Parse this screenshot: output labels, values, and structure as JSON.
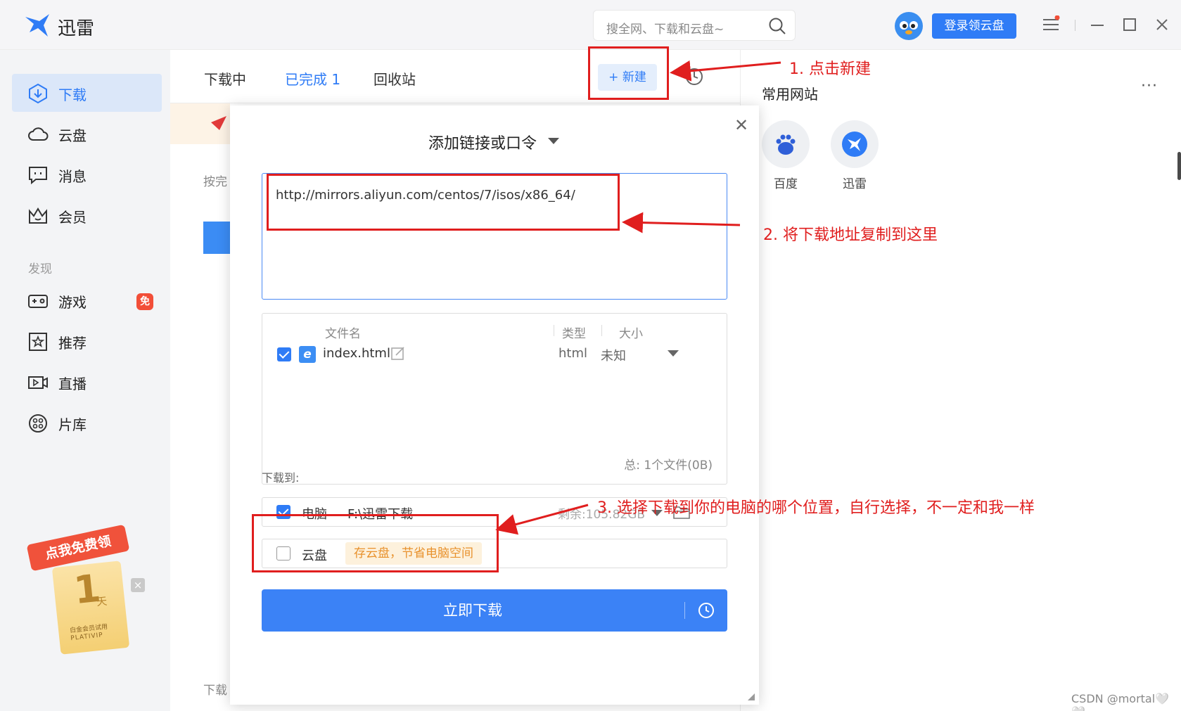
{
  "app": {
    "name": "迅雷"
  },
  "search": {
    "placeholder": "搜全网、下载和云盘~"
  },
  "header": {
    "login_label": "登录领云盘"
  },
  "sidebar": {
    "items": [
      {
        "label": "下载",
        "icon": "download-icon",
        "active": true
      },
      {
        "label": "云盘",
        "icon": "cloud-icon"
      },
      {
        "label": "消息",
        "icon": "message-icon"
      },
      {
        "label": "会员",
        "icon": "crown-icon"
      }
    ],
    "section_label": "发现",
    "discover_items": [
      {
        "label": "游戏",
        "icon": "gamepad-icon",
        "badge": "免"
      },
      {
        "label": "推荐",
        "icon": "star-icon"
      },
      {
        "label": "直播",
        "icon": "live-icon"
      },
      {
        "label": "片库",
        "icon": "film-icon"
      }
    ],
    "promo": {
      "ribbon": "点我免费领",
      "number": "1",
      "unit": "天",
      "line1": "白金会员试用",
      "line2": "PLATIVIP"
    }
  },
  "tabs": [
    {
      "label": "下载中"
    },
    {
      "label": "已完成 1",
      "active": true
    },
    {
      "label": "回收站"
    }
  ],
  "toolbar": {
    "new_label": "+ 新建"
  },
  "main": {
    "peek_text_1": "按完",
    "peek_text_2": "下载"
  },
  "right_panel": {
    "title": "常用网站",
    "more": "···",
    "sites": [
      {
        "label": "百度",
        "icon": "baidu-icon"
      },
      {
        "label": "迅雷",
        "icon": "xunlei-icon"
      }
    ]
  },
  "dialog": {
    "title": "添加链接或口令",
    "url": "http://mirrors.aliyun.com/centos/7/isos/x86_64/",
    "columns": {
      "name": "文件名",
      "type": "类型",
      "size": "大小"
    },
    "file": {
      "name": "index.html",
      "type": "html",
      "size": "未知",
      "checked": true
    },
    "total": "总:   1个文件(0B)",
    "save_to_label": "下载到:",
    "pc": {
      "label": "电脑",
      "path": "F:\\迅雷下载",
      "free": "剩余:105.82GB",
      "checked": true
    },
    "cloud": {
      "label": "云盘",
      "tip": "存云盘，节省电脑空间",
      "checked": false
    },
    "download_label": "立即下载"
  },
  "annotations": {
    "step1": "1. 点击新建",
    "step2": "2. 将下载地址复制到这里",
    "step3": "3. 选择下载到你的电脑的哪个位置，自行选择，不一定和我一样"
  },
  "colors": {
    "accent": "#2f7cf6",
    "annotation": "#e01e1e",
    "tip": "#e8912c"
  },
  "watermark": "CSDN @mortal🤍🤍"
}
